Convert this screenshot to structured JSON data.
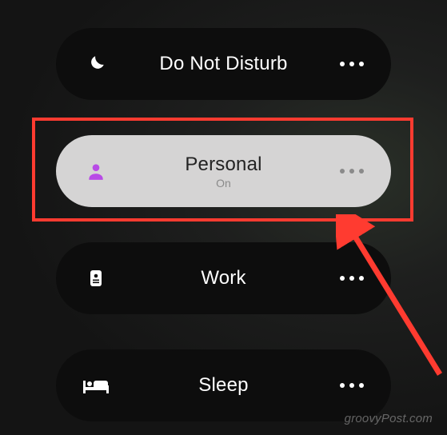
{
  "focus_modes": [
    {
      "id": "dnd",
      "label": "Do Not Disturb",
      "sublabel": "",
      "active": false,
      "icon": "moon",
      "theme": "dark"
    },
    {
      "id": "personal",
      "label": "Personal",
      "sublabel": "On",
      "active": true,
      "icon": "person",
      "theme": "light"
    },
    {
      "id": "work",
      "label": "Work",
      "sublabel": "",
      "active": false,
      "icon": "badge",
      "theme": "dark"
    },
    {
      "id": "sleep",
      "label": "Sleep",
      "sublabel": "",
      "active": false,
      "icon": "bed",
      "theme": "dark"
    }
  ],
  "annotation": {
    "highlight_target": "personal",
    "highlight_color": "#ff3b30",
    "arrow_color": "#ff3b30"
  },
  "watermark": "groovyPost.com",
  "colors": {
    "icon_purple": "#b84be6",
    "dark_pill": "#0d0d0d",
    "light_pill": "#d5d4d4"
  }
}
